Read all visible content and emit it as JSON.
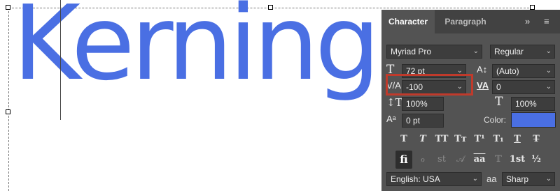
{
  "document": {
    "sample_text": "Kerning"
  },
  "panel": {
    "tabs": [
      "Character",
      "Paragraph"
    ],
    "menu_icons": {
      "collapse": "double-chevron-right-icon",
      "menu": "hamburger-menu-icon"
    },
    "font_family": "Myriad Pro",
    "font_style": "Regular",
    "font_size": "72 pt",
    "leading": "(Auto)",
    "kerning": "-100",
    "tracking": "0",
    "vertical_scale": "100%",
    "horizontal_scale": "100%",
    "baseline_shift": "0 pt",
    "color_label": "Color:",
    "color_value": "#4a6fe3",
    "type_style_buttons": [
      "T",
      "T",
      "TT",
      "Tт",
      "T¹",
      "T₁",
      "T",
      "T̶"
    ],
    "opentype_buttons": [
      "fi",
      "ℴ",
      "st",
      "𝒜",
      "aa",
      "𝕋",
      "1st",
      "½"
    ],
    "language": "English: USA",
    "aa_label": "aa",
    "antialias": "Sharp"
  }
}
